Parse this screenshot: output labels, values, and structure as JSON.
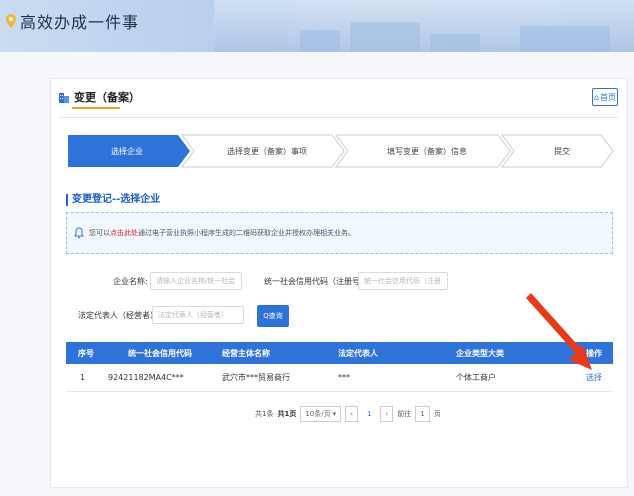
{
  "header": {
    "title": "高效办成一件事"
  },
  "breadcrumb": {
    "label": "变更（备案）"
  },
  "home_button": {
    "label": "首页"
  },
  "steps": [
    {
      "label": "选择企业",
      "active": true
    },
    {
      "label": "选择变更（备案）事项",
      "active": false
    },
    {
      "label": "填写变更（备案）信息",
      "active": false
    },
    {
      "label": "提交",
      "active": false
    }
  ],
  "section": {
    "title": "变更登记--选择企业"
  },
  "notice": {
    "prefix": "您可以",
    "link": "点击此处",
    "suffix": "通过电子营业执照小程序生成的二维码获取企业并授权办理相关业务。"
  },
  "search": {
    "company_name_label": "企业名称:",
    "company_name_placeholder": "请输入企业名称/统一社会",
    "credit_code_label": "统一社会信用代码（注册号）:",
    "credit_code_placeholder": "统一社会信用代码（注册",
    "legal_rep_label": "法定代表人（经营者）:",
    "legal_rep_placeholder": "法定代表人（经营者）",
    "button_label": "Q查询"
  },
  "table": {
    "columns": [
      "序号",
      "统一社会信用代码",
      "经营主体名称",
      "法定代表人",
      "企业类型大类",
      "操作"
    ],
    "rows": [
      {
        "index": "1",
        "credit_code": "92421182MA4C***",
        "name": "武穴市***贸易商行",
        "legal_rep": "***",
        "type": "个体工商户",
        "action": "选择"
      }
    ]
  },
  "pagination": {
    "total_prefix": "共1条",
    "pages": "共1页",
    "page_size": "10条/页",
    "goto_label": "前往",
    "current": "1",
    "page_suffix": "页"
  },
  "colors": {
    "primary": "#2f73d9",
    "accent": "#f0a020",
    "annotation_arrow": "#e63a1c"
  }
}
